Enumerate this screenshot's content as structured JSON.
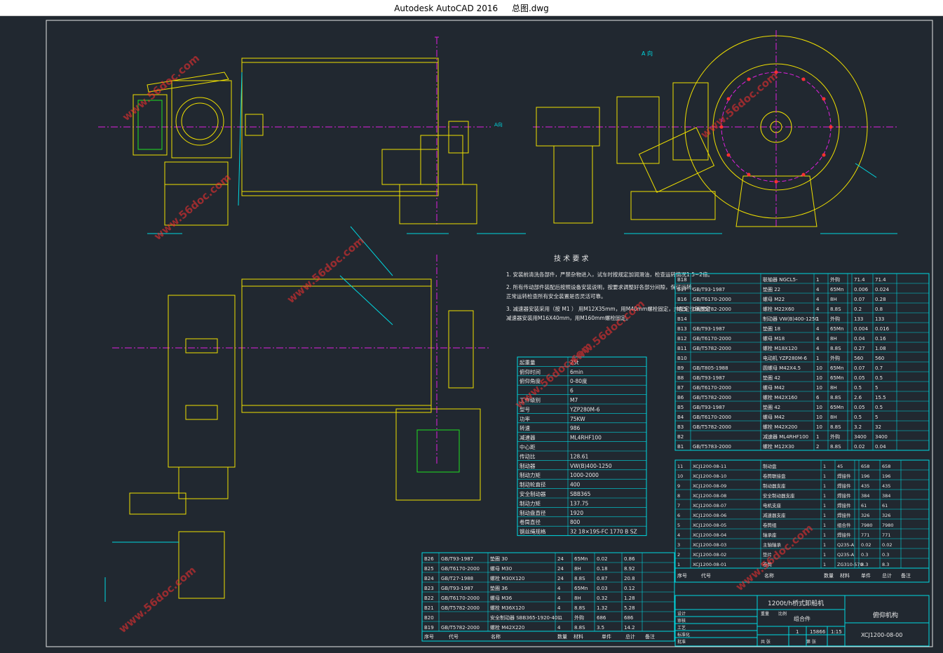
{
  "app": {
    "name": "Autodesk AutoCAD 2016",
    "file": "总图.dwg"
  },
  "colors": {
    "background": "#212830",
    "yellow": "#f0e000",
    "cyan": "#00d8e0",
    "magenta": "#e020e0",
    "white": "#e8e8e8",
    "green": "#20e020",
    "red": "#ff3030"
  },
  "view_a": {
    "label": "A 向"
  },
  "a_arrow": {
    "label": "A向"
  },
  "tech": {
    "title": "技 术 要 求",
    "lines": [
      "1. 安装前清洗各部件，严禁杂物进入，试车时按规定加润滑油，检查运转情况1.5~2倍。",
      "2. 所有传动部件装配后按照设备安装说明，按要求调整好各部分间隙，保证运转。",
      "   正常运转检查所有安全装置是否灵活可靠。",
      "3. 减速器安装采用（按 M1 ） 用M12X35mm，用M40mm螺栓固定，并配定位销固定",
      "   减速器安装用M16X40mm，用M160mm螺栓固定。"
    ]
  },
  "params": {
    "rows": [
      [
        "起重量",
        "25t"
      ],
      [
        "俯仰时间",
        "6min"
      ],
      [
        "俯仰角度",
        "0-80度"
      ],
      [
        "",
        "6"
      ],
      [
        "工作级别",
        "M7"
      ],
      [
        "型号",
        "YZP280M-6"
      ],
      [
        "功率",
        "75KW"
      ],
      [
        "转速",
        "986"
      ],
      [
        "减速器",
        "ML4RHF100"
      ],
      [
        "中心距",
        ""
      ],
      [
        "传动比",
        "128.61"
      ],
      [
        "制动器",
        "VW(B)400-1250"
      ],
      [
        "制动力矩",
        "1000-2000"
      ],
      [
        "制动轮直径",
        "400"
      ],
      [
        "安全制动器",
        "SBB365"
      ],
      [
        "制动力矩",
        "137.75"
      ],
      [
        "制动盘直径",
        "1920"
      ],
      [
        "卷筒直径",
        "800"
      ],
      [
        "钢丝绳规格",
        "32 18×19S-FC 1770 B SZ"
      ]
    ]
  },
  "bom_upper": {
    "rows": [
      [
        "B18",
        "",
        "联轴器 NGCL5-",
        "1",
        "外购",
        "",
        "71.4",
        "71.4"
      ],
      [
        "B17",
        "GB/T93-1987",
        "垫圈 22",
        "4",
        "65Mn",
        "",
        "0.006",
        "0.024"
      ],
      [
        "B16",
        "GB/T6170-2000",
        "螺母 M22",
        "4",
        "8H",
        "",
        "0.07",
        "0.28"
      ],
      [
        "B15",
        "GB/T5782-2000",
        "螺栓 M22X60",
        "4",
        "8.8S",
        "",
        "0.2",
        "0.8"
      ],
      [
        "B14",
        "",
        "制动器 VW(B)400-1250",
        "1",
        "外购",
        "",
        "133",
        "133"
      ],
      [
        "B13",
        "GB/T93-1987",
        "垫圈 18",
        "4",
        "65Mn",
        "",
        "0.004",
        "0.016"
      ],
      [
        "B12",
        "GB/T6170-2000",
        "螺母 M18",
        "4",
        "8H",
        "",
        "0.04",
        "0.16"
      ],
      [
        "B11",
        "GB/T5782-2000",
        "螺栓 M18X120",
        "4",
        "8.8S",
        "",
        "0.27",
        "1.08"
      ],
      [
        "B10",
        "",
        "电动机 YZP280M-6",
        "1",
        "外购",
        "",
        "560",
        "560"
      ],
      [
        "B9",
        "GB/T805-1988",
        "圆螺母 M42X4.5",
        "10",
        "65Mn",
        "",
        "0.07",
        "0.7"
      ],
      [
        "B8",
        "GB/T93-1987",
        "垫圈 42",
        "10",
        "65Mn",
        "",
        "0.05",
        "0.5"
      ],
      [
        "B7",
        "GB/T6170-2000",
        "螺母 M42",
        "10",
        "8H",
        "",
        "0.5",
        "5"
      ],
      [
        "B6",
        "GB/T5782-2000",
        "螺栓 M42X160",
        "6",
        "8.8S",
        "",
        "2.6",
        "15.5"
      ],
      [
        "B5",
        "GB/T93-1987",
        "垫圈 42",
        "10",
        "65Mn",
        "",
        "0.05",
        "0.5"
      ],
      [
        "B4",
        "GB/T6170-2000",
        "螺母 M42",
        "10",
        "8H",
        "",
        "0.5",
        "5"
      ],
      [
        "B3",
        "GB/T5782-2000",
        "螺栓 M42X200",
        "10",
        "8.8S",
        "",
        "3.2",
        "32"
      ],
      [
        "B2",
        "",
        "减速器 ML4RHF100",
        "1",
        "外购",
        "",
        "3400",
        "3400"
      ],
      [
        "B1",
        "GB/T5783-2000",
        "螺栓 M12X30",
        "2",
        "8.8S",
        "",
        "0.02",
        "0.04"
      ]
    ]
  },
  "bom_lower": {
    "rows": [
      [
        "11",
        "XCJ1200-08-11",
        "制动盘",
        "1",
        "45",
        "",
        "658",
        "658"
      ],
      [
        "10",
        "XCJ1200-08-10",
        "卷筒联接盘",
        "1",
        "焊接件",
        "",
        "196",
        "196"
      ],
      [
        "9",
        "XCJ1200-08-09",
        "制动器支座",
        "1",
        "焊接件",
        "",
        "435",
        "435"
      ],
      [
        "8",
        "XCJ1200-08-08",
        "安全制动器支座",
        "1",
        "焊接件",
        "",
        "384",
        "384"
      ],
      [
        "7",
        "XCJ1200-08-07",
        "电机支座",
        "1",
        "焊接件",
        "",
        "61",
        "61"
      ],
      [
        "6",
        "XCJ1200-08-06",
        "减速器支座",
        "1",
        "焊接件",
        "",
        "326",
        "326"
      ],
      [
        "5",
        "XCJ1200-08-05",
        "卷筒组",
        "1",
        "组合件",
        "",
        "7980",
        "7980"
      ],
      [
        "4",
        "XCJ1200-08-04",
        "轴承座",
        "1",
        "焊接件",
        "",
        "771",
        "771"
      ],
      [
        "3",
        "XCJ1200-08-03",
        "主轴轴承",
        "1",
        "Q235-A",
        "",
        "0.02",
        "0.02"
      ],
      [
        "2",
        "XCJ1200-08-02",
        "垫片",
        "1",
        "Q235-A",
        "",
        "0.3",
        "0.3"
      ],
      [
        "1",
        "XCJ1200-08-01",
        "卷筒",
        "1",
        "ZG310-570",
        "",
        "8.3",
        "8.3"
      ]
    ],
    "header": [
      "序号",
      "代号",
      "名称",
      "数量",
      "材料",
      "单件",
      "总计",
      "备注"
    ]
  },
  "bom_left": {
    "rows": [
      [
        "B26",
        "GB/T93-1987",
        "垫圈 30",
        "24",
        "65Mn",
        "0.02",
        "0.86"
      ],
      [
        "B25",
        "GB/T6170-2000",
        "螺母 M30",
        "24",
        "8H",
        "0.18",
        "8.92"
      ],
      [
        "B24",
        "GB/T27-1988",
        "螺栓 M30X120",
        "24",
        "8.8S",
        "0.87",
        "20.8"
      ],
      [
        "B23",
        "GB/T93-1987",
        "垫圈 36",
        "4",
        "65Mn",
        "0.03",
        "0.12"
      ],
      [
        "B22",
        "GB/T6170-2000",
        "螺母 M36",
        "4",
        "8H",
        "0.32",
        "1.28"
      ],
      [
        "B21",
        "GB/T5782-2000",
        "螺栓 M36X120",
        "4",
        "8.8S",
        "1.32",
        "5.28"
      ],
      [
        "B20",
        "",
        "安全制动器 SBB365-1920-40-1",
        "1",
        "外购",
        "686",
        "686"
      ],
      [
        "B19",
        "GB/T5782-2000",
        "螺栓 M42X220",
        "4",
        "8.8S",
        "3.5",
        "14.2"
      ]
    ],
    "header": [
      "序号",
      "代号",
      "名称",
      "数量",
      "材料",
      "单件",
      "总计",
      "备注"
    ]
  },
  "titleblock": {
    "project": "1200t/h桥式卸船机",
    "assembly": "组合件",
    "name": "俯仰机构",
    "drawing_no": "XCJ1200-08-00",
    "weight": "15866",
    "scale": "1:15",
    "qty": "1",
    "labels": [
      "设计",
      "审核",
      "工艺",
      "标准化",
      "批准",
      "重量",
      "比例",
      "共 张",
      "第 张"
    ]
  },
  "watermark": "www.56doc.com"
}
